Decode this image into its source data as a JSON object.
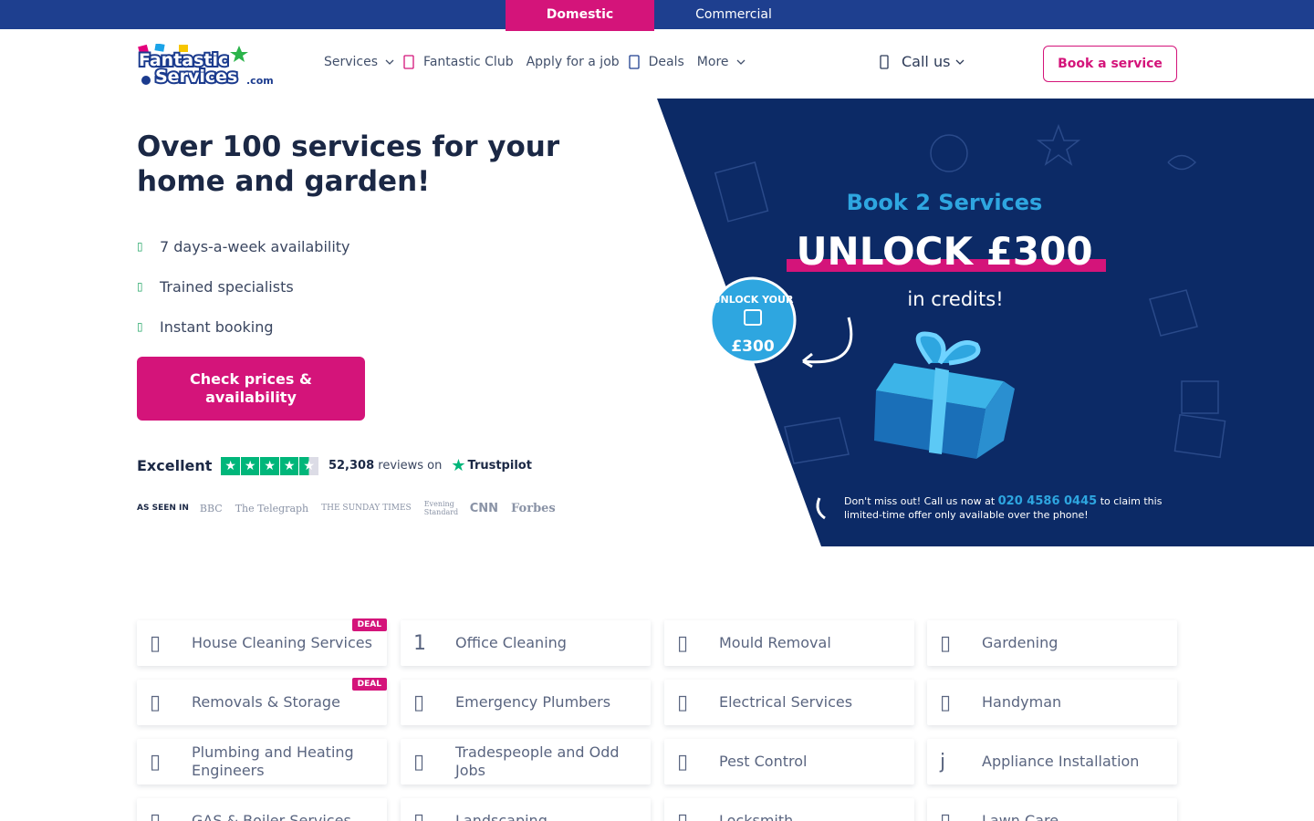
{
  "topbar": {
    "domestic": "Domestic",
    "commercial": "Commercial"
  },
  "header": {
    "logo_text": "Fantastic Services.com",
    "nav": [
      {
        "label": "Services",
        "icon": "chevron-down-icon"
      },
      {
        "label": "Fantastic Club",
        "icon": "club-icon"
      },
      {
        "label": "Apply for a job",
        "icon": ""
      },
      {
        "label": "Deals",
        "icon": "deals-icon"
      },
      {
        "label": "More",
        "icon": "chevron-down-icon"
      }
    ],
    "call_us": "Call us",
    "book": "Book a service"
  },
  "hero": {
    "title": "Over 100 services for your home and garden!",
    "features": [
      "7 days-a-week availability",
      "Trained specialists",
      "Instant booking"
    ],
    "cta": "Check prices & availability",
    "trust": {
      "excellent": "Excellent",
      "count": "52,308",
      "reviews_on": "reviews on",
      "platform": "Trustpilot",
      "rating_stars": 4.5
    },
    "seen_in": {
      "label": "AS SEEN IN",
      "media": [
        "BBC",
        "The Telegraph",
        "THE SUNDAY TIMES",
        "Evening Standard",
        "CNN",
        "Forbes"
      ]
    }
  },
  "banner": {
    "headline": "Book 2 Services",
    "unlock": "UNLOCK £300",
    "credits": "in credits!",
    "badge_top": "UNLOCK YOUR",
    "badge_amount": "£300",
    "note_1": "Don't miss out! Call us now at",
    "phone": "020 4586 0445",
    "note_2": "to claim this",
    "note_3": "limited-time offer only available over the phone!",
    "colors": {
      "bg": "#0c2a66",
      "accent": "#2ea6e0",
      "pink": "#d4147a"
    }
  },
  "services": [
    {
      "label": "House Cleaning Services",
      "icon": "house-icon",
      "deal": "DEAL"
    },
    {
      "label": "Office Cleaning",
      "icon": "1",
      "deal": ""
    },
    {
      "label": "Mould Removal",
      "icon": "mould-icon",
      "deal": ""
    },
    {
      "label": "Gardening",
      "icon": "gardening-icon",
      "deal": ""
    },
    {
      "label": "Removals & Storage",
      "icon": "truck-icon",
      "deal": "DEAL"
    },
    {
      "label": "Emergency Plumbers",
      "icon": "plumber-icon",
      "deal": ""
    },
    {
      "label": "Electrical Services",
      "icon": "electric-icon",
      "deal": ""
    },
    {
      "label": "Handyman",
      "icon": "handyman-icon",
      "deal": ""
    },
    {
      "label": "Plumbing and Heating Engineers",
      "icon": "heating-icon",
      "deal": ""
    },
    {
      "label": "Tradespeople and Odd Jobs",
      "icon": "tools-icon",
      "deal": ""
    },
    {
      "label": "Pest Control",
      "icon": "pest-icon",
      "deal": ""
    },
    {
      "label": "Appliance Installation",
      "icon": "j",
      "deal": ""
    },
    {
      "label": "GAS & Boiler Services",
      "icon": "boiler-icon",
      "deal": ""
    },
    {
      "label": "Landscaping",
      "icon": "landscaping-icon",
      "deal": ""
    },
    {
      "label": "Locksmith",
      "icon": "lock-icon",
      "deal": ""
    },
    {
      "label": "Lawn Care",
      "icon": "lawn-icon",
      "deal": ""
    }
  ]
}
